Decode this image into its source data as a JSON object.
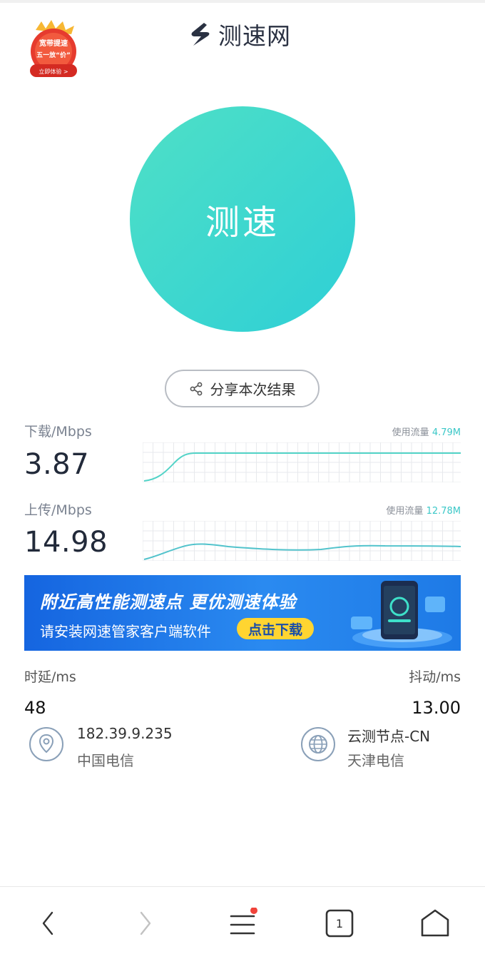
{
  "header": {
    "logo_text": "测速网",
    "promo": {
      "line1": "宽带提速",
      "line2": "五一放“价”",
      "cta": "立即体验 >"
    }
  },
  "main": {
    "start_button": "测速",
    "share_button": "分享本次结果"
  },
  "download": {
    "label": "下载/Mbps",
    "value": "3.87",
    "usage_label": "使用流量",
    "usage_value": "4.79M"
  },
  "upload": {
    "label": "上传/Mbps",
    "value": "14.98",
    "usage_label": "使用流量",
    "usage_value": "12.78M"
  },
  "banner": {
    "title": "附近高性能测速点  更优测速体验",
    "subtitle": "请安装网速管家客户端软件",
    "cta": "点击下载"
  },
  "stats": {
    "latency_label": "时延/ms",
    "latency_value": "48",
    "jitter_label": "抖动/ms",
    "jitter_value": "13.00"
  },
  "client": {
    "ip": "182.39.9.235",
    "isp": "中国电信",
    "icon": "location-pin-icon"
  },
  "server": {
    "node": "云测节点-CN",
    "isp": "天津电信",
    "icon": "globe-icon"
  },
  "nav": {
    "tab_count": "1",
    "has_notification": true
  },
  "colors": {
    "accent": "#2ecfd6",
    "accent_light": "#4fe0c6",
    "banner_blue": "#1e7ae6",
    "cta_yellow": "#ffd531"
  }
}
